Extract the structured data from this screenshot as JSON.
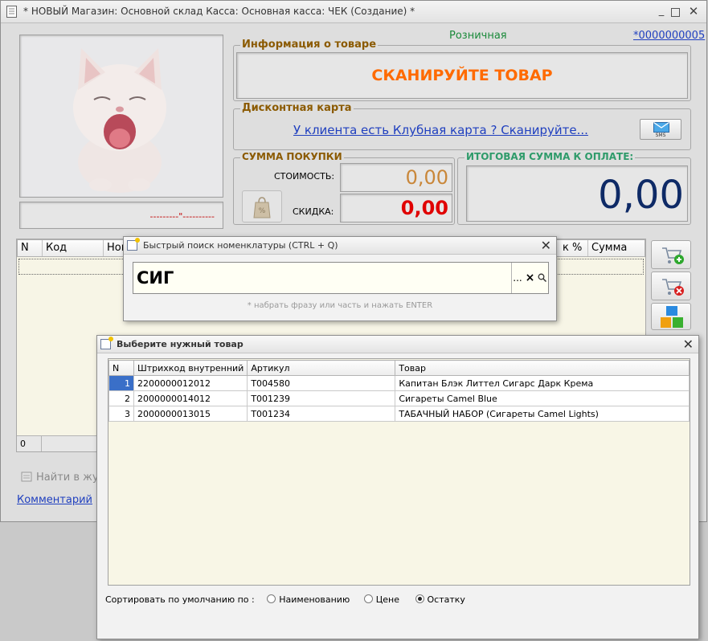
{
  "main_window": {
    "title": "* НОВЫЙ Магазин: Основной склад Касса: Основная касса: ЧЕК (Создание) *",
    "price_type": "Розничная",
    "doc_number": "*0000000005",
    "product_info": {
      "legend": "Информация о товаре",
      "message": "СКАНИРУЙТЕ ТОВАР"
    },
    "discount": {
      "legend": "Дисконтная карта",
      "link": "У клиента есть Клубная карта ? Сканируйте...",
      "sms_label": "SMS"
    },
    "purchase": {
      "legend": "СУММА ПОКУПКИ",
      "cost_label": "СТОИМОСТЬ:",
      "cost_value": "0,00",
      "discount_label": "СКИДКА:",
      "discount_value": "0,00"
    },
    "total": {
      "legend": "ИТОГОВАЯ СУММА К ОПЛАТЕ:",
      "value": "0,00"
    },
    "cashier_line": "---------\"----------",
    "grid_columns": [
      "N",
      "Код",
      "Ном",
      "к %",
      "Сумма"
    ],
    "footer_count": "0",
    "find_in_journal": "Найти в жур",
    "comment_link": "Комментарий"
  },
  "quick_search": {
    "title": "Быстрый поиск номенклатуры (CTRL + Q)",
    "value": "СИГ",
    "hint": "* набрать фразу или часть и нажать ENTER",
    "btn_select": "...",
    "btn_clear": "×"
  },
  "select_product": {
    "title": "Выберите нужный товар",
    "columns": [
      "N",
      "Штрихкод внутренний",
      "Артикул",
      "Товар"
    ],
    "rows": [
      {
        "n": "1",
        "barcode": "2200000012012",
        "article": "T004580",
        "product": "Капитан Блэк Литтел Сигарс Дарк Крема"
      },
      {
        "n": "2",
        "barcode": "2000000014012",
        "article": "T001239",
        "product": "Сигареты Camel Blue"
      },
      {
        "n": "3",
        "barcode": "2000000013015",
        "article": "T001234",
        "product": "ТАБАЧНЫЙ НАБОР (Сигареты Camel Lights)"
      }
    ],
    "sort_label": "Сортировать по умолчанию по :",
    "sort_options": [
      "Наименованию",
      "Цене",
      "Остатку"
    ]
  },
  "colors": {
    "accent_orange": "#ff6a00",
    "discount_red": "#e00000",
    "cost_tan": "#c9873a",
    "total_navy": "#0e2a66",
    "legend_brown": "#8b5a00",
    "legend_green": "#2e9b6a",
    "price_type_green": "#1a8a3a",
    "link_blue": "#1f3fbf"
  }
}
